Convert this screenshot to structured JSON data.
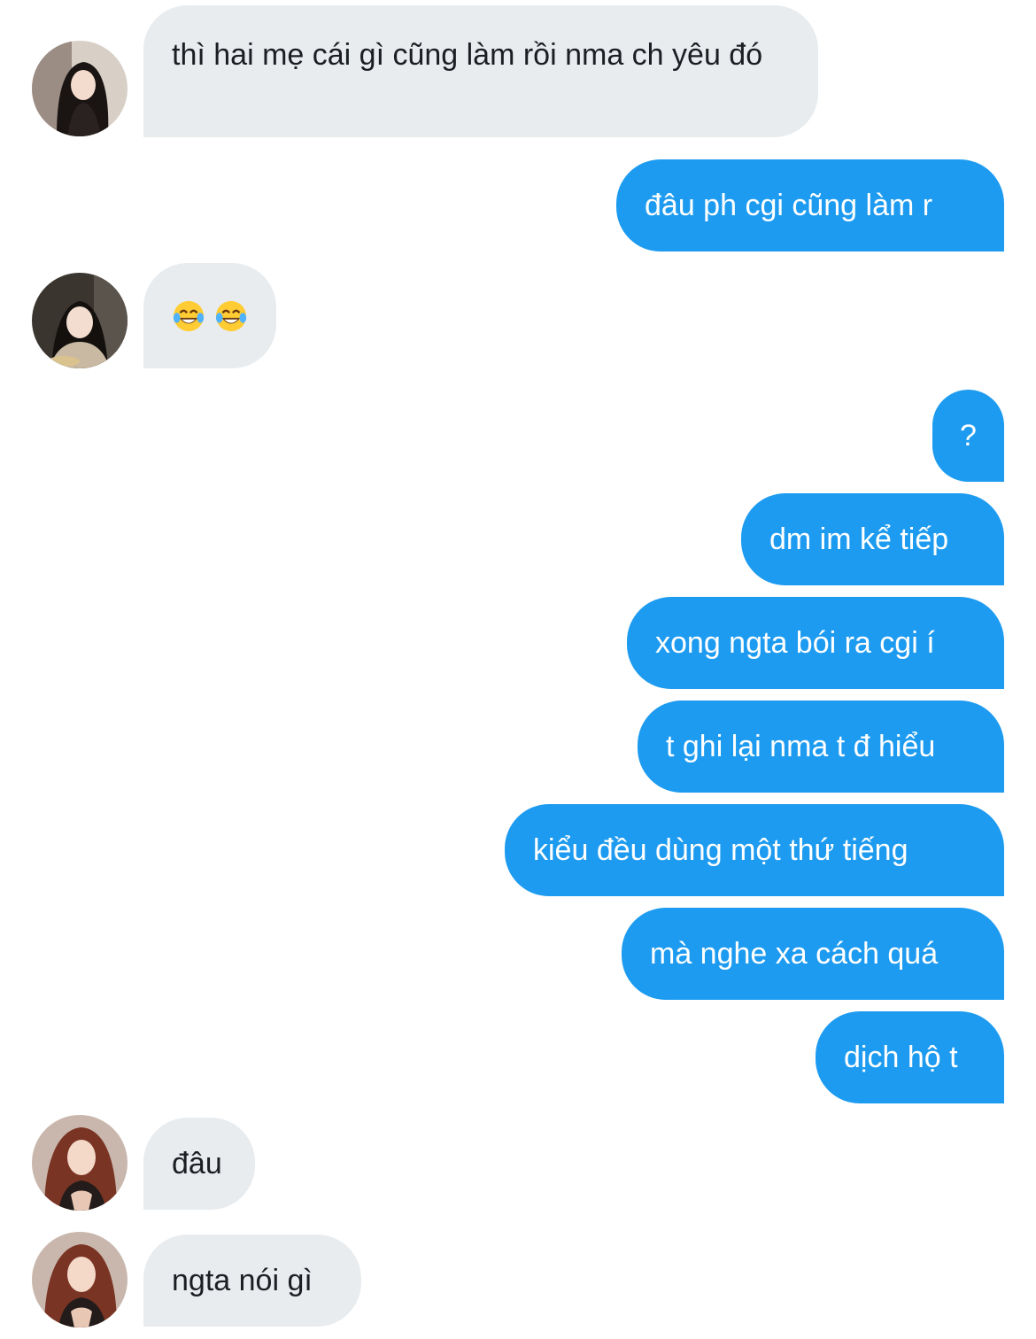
{
  "conversation": {
    "messages": [
      {
        "sender": "them",
        "avatar": "avatar-1",
        "text": "thì hai mẹ cái gì cũng làm rồi nma ch yêu đó"
      },
      {
        "sender": "me",
        "text": "đâu ph cgi cũng làm r"
      },
      {
        "sender": "them",
        "avatar": "avatar-2",
        "emojis": [
          "face-with-tears-of-joy",
          "face-with-tears-of-joy"
        ]
      },
      {
        "sender": "me",
        "text": "?"
      },
      {
        "sender": "me",
        "text": "dm im kể tiếp"
      },
      {
        "sender": "me",
        "text": "xong ngta bói ra cgi í"
      },
      {
        "sender": "me",
        "text": "t ghi lại nma t đ hiểu"
      },
      {
        "sender": "me",
        "text": "kiểu đều dùng một thứ tiếng"
      },
      {
        "sender": "me",
        "text": "mà nghe xa cách quá"
      },
      {
        "sender": "me",
        "text": "dịch hộ t"
      },
      {
        "sender": "them",
        "avatar": "avatar-3",
        "text": "đâu"
      },
      {
        "sender": "them",
        "avatar": "avatar-3",
        "text": "ngta nói gì"
      }
    ]
  },
  "colors": {
    "incoming_bubble": "#e8ecef",
    "outgoing_bubble": "#1d9bf0",
    "incoming_text": "#1b1f23",
    "outgoing_text": "#ffffff",
    "background": "#ffffff"
  }
}
